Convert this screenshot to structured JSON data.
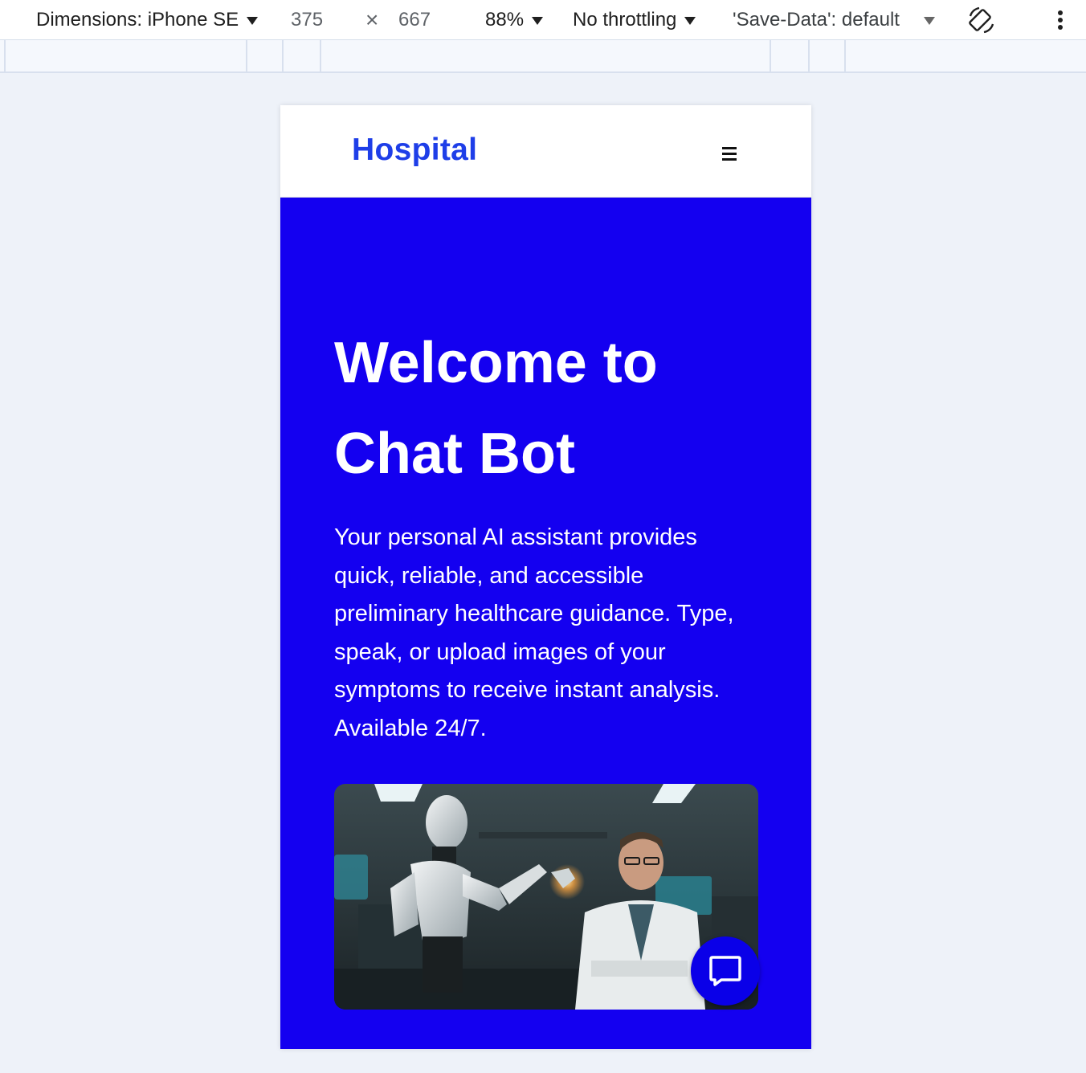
{
  "devtools": {
    "device_label": "Dimensions: iPhone SE",
    "width": "375",
    "times": "×",
    "height": "667",
    "zoom": "88%",
    "throttling": "No throttling",
    "save_data": "'Save-Data': default"
  },
  "nav": {
    "brand": "Hospital",
    "menu_icon": "hamburger-menu-icon"
  },
  "hero": {
    "title": "Welcome to Chat Bot",
    "description": "Your personal AI assistant provides quick, reliable, and accessible preliminary healthcare guidance. Type, speak, or upload images of your symptoms to receive instant analysis. Available 24/7.",
    "image_icon": "robot-and-doctor-lab-illustration",
    "chat_icon": "chat-bubble-icon"
  },
  "colors": {
    "brand": "#1e3ee8",
    "hero_bg": "#1400f0",
    "fab": "#0a00e8"
  }
}
